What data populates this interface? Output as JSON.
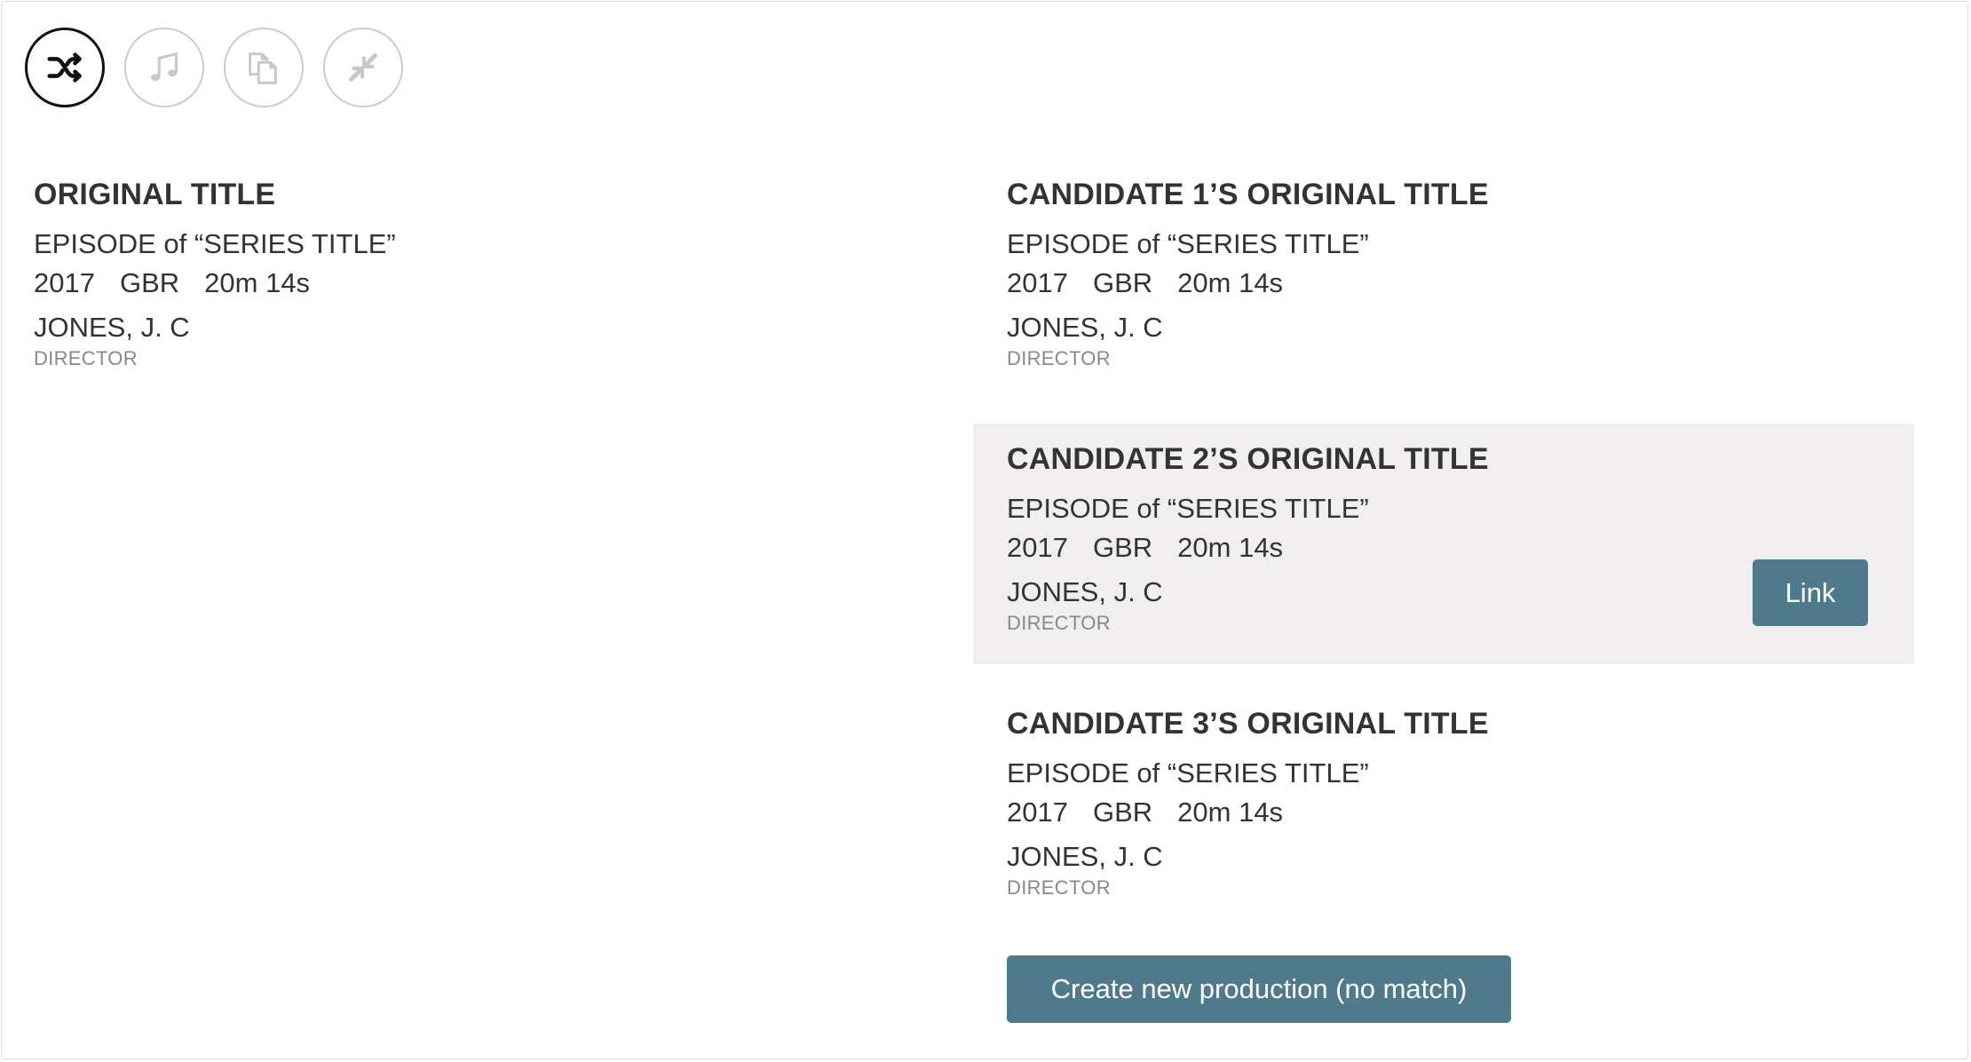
{
  "toolbar": {
    "buttons": [
      {
        "icon": "shuffle-icon",
        "active": true
      },
      {
        "icon": "music-note-icon",
        "active": false
      },
      {
        "icon": "copy-icon",
        "active": false
      },
      {
        "icon": "collapse-icon",
        "active": false
      }
    ]
  },
  "original": {
    "title": "ORIGINAL TITLE",
    "subtitle": "EPISODE of “SERIES TITLE”",
    "year": "2017",
    "country": "GBR",
    "duration": "20m 14s",
    "person": "JONES, J. C",
    "role": "DIRECTOR"
  },
  "candidates": [
    {
      "title": "CANDIDATE 1’S ORIGINAL TITLE",
      "subtitle": "EPISODE of “SERIES TITLE”",
      "year": "2017",
      "country": "GBR",
      "duration": "20m 14s",
      "person": "JONES, J. C",
      "role": "DIRECTOR"
    },
    {
      "title": "CANDIDATE 2’S ORIGINAL TITLE",
      "subtitle": "EPISODE of “SERIES TITLE”",
      "year": "2017",
      "country": "GBR",
      "duration": "20m 14s",
      "person": "JONES, J. C",
      "role": "DIRECTOR",
      "highlighted": true,
      "link_label": "Link"
    },
    {
      "title": "CANDIDATE 3’S ORIGINAL TITLE",
      "subtitle": "EPISODE of “SERIES TITLE”",
      "year": "2017",
      "country": "GBR",
      "duration": "20m 14s",
      "person": "JONES, J. C",
      "role": "DIRECTOR"
    }
  ],
  "create_button_label": "Create new production (no match)",
  "colors": {
    "button": "#4f7a8c",
    "highlight": "#f0eeef",
    "text": "#333333",
    "muted": "#888888"
  }
}
